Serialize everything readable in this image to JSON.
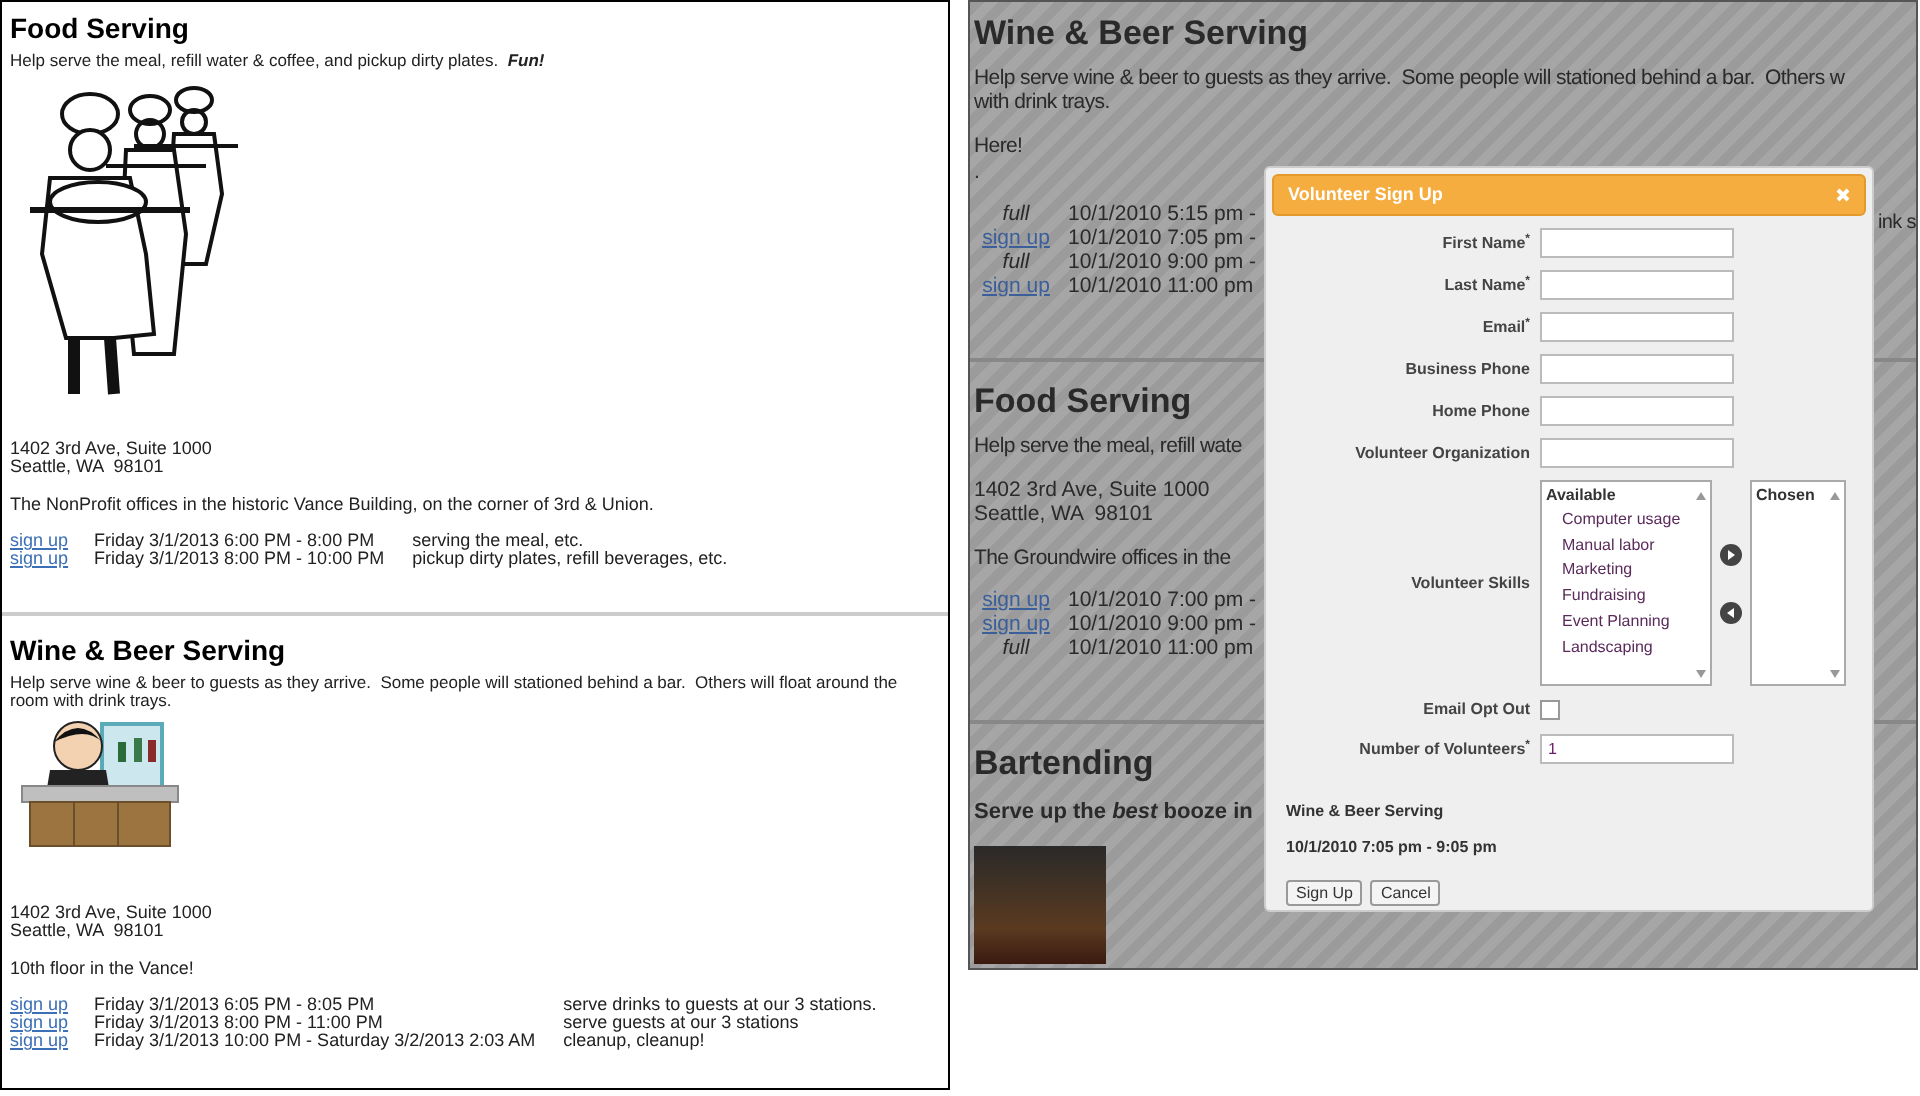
{
  "left_page": {
    "sections": [
      {
        "title": "Food Serving",
        "description": "Help serve the meal, refill water & coffee, and pickup dirty plates.  *Fun!*",
        "kind": "waiters",
        "address_lines": [
          "1402 3rd Ave, Suite 1000",
          "Seattle, WA  98101"
        ],
        "note": "The NonProfit offices in the historic Vance Building, on the corner of 3rd & Union.",
        "slots": [
          {
            "link": "sign up",
            "time": "Friday 3/1/2013 6:00 PM - 8:00 PM",
            "task": "serving the meal, etc."
          },
          {
            "link": "sign up",
            "time": "Friday 3/1/2013 8:00 PM - 10:00 PM",
            "task": "pickup dirty plates, refill beverages, etc."
          }
        ]
      },
      {
        "title": "Wine & Beer Serving",
        "description": "Help serve wine & beer to guests as they arrive.  Some people will stationed behind a bar.  Others will float around the room with drink trays.",
        "kind": "bartender",
        "address_lines": [
          "1402 3rd Ave, Suite 1000",
          "Seattle, WA  98101"
        ],
        "note": "10th floor in the Vance!",
        "slots": [
          {
            "link": "sign up",
            "time": "Friday 3/1/2013 6:05 PM - 8:05 PM",
            "task": "serve drinks to guests at our 3 stations."
          },
          {
            "link": "sign up",
            "time": "Friday 3/1/2013 8:00 PM - 11:00 PM",
            "task": "serve guests at our 3 stations"
          },
          {
            "link": "sign up",
            "time": "Friday 3/1/2013 10:00 PM - Saturday 3/2/2013 2:03 AM",
            "task": "cleanup, cleanup!"
          }
        ]
      }
    ]
  },
  "right_page": {
    "sections": [
      {
        "title": "Wine & Beer Serving",
        "description_lines": [
          "Help serve wine & beer to guests as they arrive.  Some people will stationed behind a bar.  Others w",
          "with drink trays."
        ],
        "notes": [
          "Here!",
          "."
        ],
        "slots": [
          {
            "kind": "full",
            "label": "full",
            "time": "10/1/2010 5:15 pm -"
          },
          {
            "kind": "link",
            "label": "sign up",
            "time": "10/1/2010 7:05 pm -"
          },
          {
            "kind": "full",
            "label": "full",
            "time": "10/1/2010 9:00 pm -"
          },
          {
            "kind": "link",
            "label": "sign up",
            "time": "10/1/2010 11:00 pm"
          }
        ],
        "cut_text": "ink s"
      },
      {
        "title": "Food Serving",
        "description_lines": [
          "Help serve the meal, refill wate"
        ],
        "address_lines": [
          "1402 3rd Ave, Suite 1000",
          "Seattle, WA  98101"
        ],
        "notes": [
          "The Groundwire offices in the"
        ],
        "slots": [
          {
            "kind": "link",
            "label": "sign up",
            "time": "10/1/2010 7:00 pm -"
          },
          {
            "kind": "link",
            "label": "sign up",
            "time": "10/1/2010 9:00 pm -"
          },
          {
            "kind": "full",
            "label": "full",
            "time": "10/1/2010 11:00 pm"
          }
        ]
      },
      {
        "title": "Bartending",
        "subtitle": "Serve up the *best* booze in",
        "kind": "photo"
      }
    ]
  },
  "dialog": {
    "title": "Volunteer Sign Up",
    "fields": [
      {
        "kind": "text",
        "label": "First Name$^{*}$"
      },
      {
        "kind": "text",
        "label": "Last Name$^{*}$"
      },
      {
        "kind": "text",
        "label": "Email$^{*}$"
      },
      {
        "kind": "text",
        "label": "Business Phone"
      },
      {
        "kind": "text",
        "label": "Home Phone"
      },
      {
        "kind": "text",
        "label": "Volunteer Organization"
      },
      {
        "kind": "skills",
        "label": "Volunteer Skills",
        "available_heading": "Available",
        "available": [
          "Computer usage",
          "Manual labor",
          "Marketing",
          "Fundraising",
          "Event Planning",
          "Landscaping"
        ],
        "chosen_heading": "Chosen"
      },
      {
        "kind": "checkbox",
        "label": "Email Opt Out",
        "checked": false
      },
      {
        "kind": "text",
        "label": "Number of Volunteers$^{*}$",
        "value": "1"
      }
    ],
    "summary_title": "Wine & Beer Serving",
    "summary_time": "10/1/2010 7:05 pm - 9:05 pm",
    "buttons": [
      "Sign Up",
      "Cancel"
    ]
  }
}
